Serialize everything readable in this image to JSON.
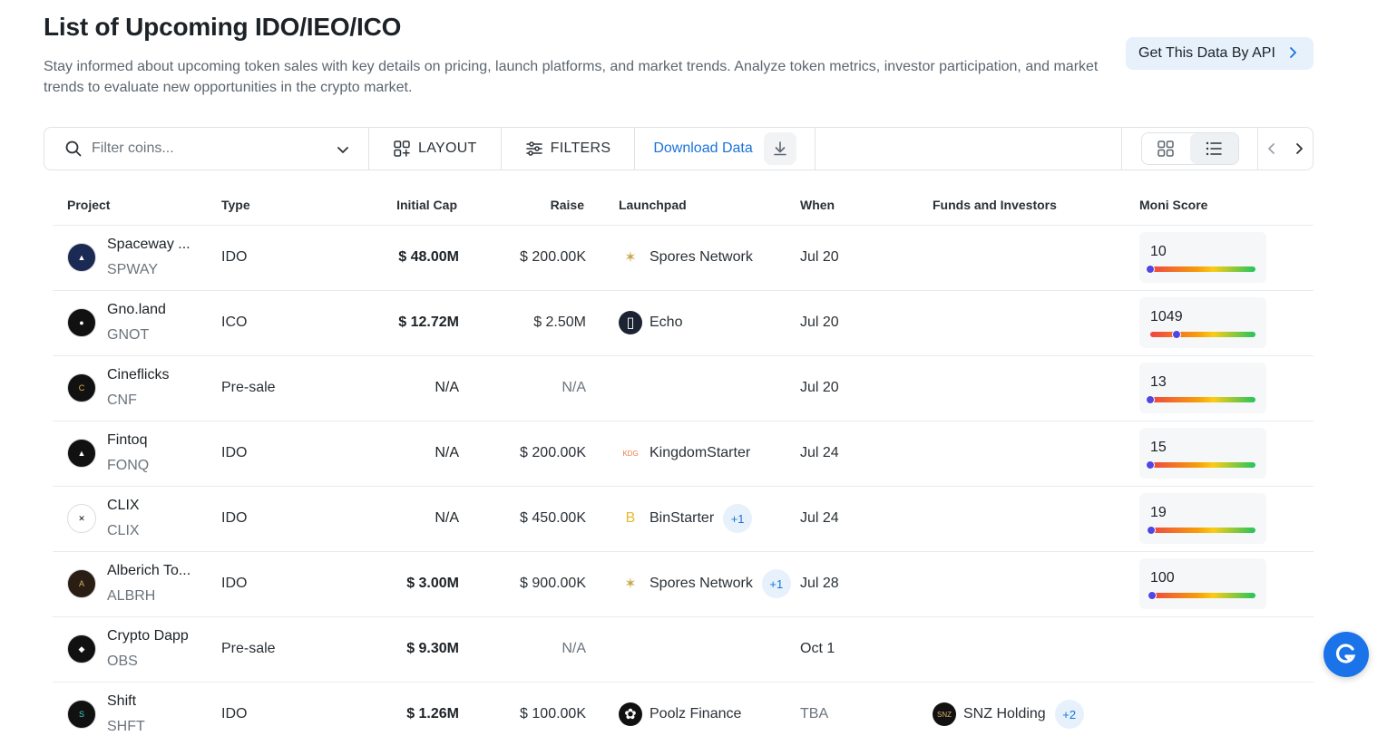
{
  "header": {
    "title": "List of Upcoming IDO/IEO/ICO",
    "subtitle": "Stay informed about upcoming token sales with key details on pricing, launch platforms, and market trends. Analyze token metrics, investor participation, and market trends to evaluate new opportunities in the crypto market.",
    "api_button": "Get This Data By API"
  },
  "toolbar": {
    "search_placeholder": "Filter coins...",
    "layout_label": "LAYOUT",
    "filters_label": "FILTERS",
    "download_label": "Download Data"
  },
  "table": {
    "columns": [
      "Project",
      "Type",
      "Initial Cap",
      "Raise",
      "Launchpad",
      "When",
      "Funds and Investors",
      "Moni Score"
    ],
    "rows": [
      {
        "name": "Spaceway ...",
        "symbol": "SPWAY",
        "type": "IDO",
        "cap": "$ 48.00M",
        "raise": "$ 200.00K",
        "launchpad": "Spores Network",
        "lp_extra": "",
        "when": "Jul 20",
        "funds": "",
        "funds_extra": "",
        "score": "10",
        "score_pos": 0.0
      },
      {
        "name": "Gno.land",
        "symbol": "GNOT",
        "type": "ICO",
        "cap": "$ 12.72M",
        "raise": "$ 2.50M",
        "launchpad": "Echo",
        "lp_extra": "",
        "when": "Jul 20",
        "funds": "",
        "funds_extra": "",
        "score": "1049",
        "score_pos": 0.25
      },
      {
        "name": "Cineflicks",
        "symbol": "CNF",
        "type": "Pre-sale",
        "cap": "N/A",
        "raise": "N/A",
        "launchpad": "",
        "lp_extra": "",
        "when": "Jul 20",
        "funds": "",
        "funds_extra": "",
        "score": "13",
        "score_pos": 0.0
      },
      {
        "name": "Fintoq",
        "symbol": "FONQ",
        "type": "IDO",
        "cap": "N/A",
        "raise": "$ 200.00K",
        "launchpad": "KingdomStarter",
        "lp_extra": "",
        "when": "Jul 24",
        "funds": "",
        "funds_extra": "",
        "score": "15",
        "score_pos": 0.0
      },
      {
        "name": "CLIX",
        "symbol": "CLIX",
        "type": "IDO",
        "cap": "N/A",
        "raise": "$ 450.00K",
        "launchpad": "BinStarter",
        "lp_extra": "+1",
        "when": "Jul 24",
        "funds": "",
        "funds_extra": "",
        "score": "19",
        "score_pos": 0.01
      },
      {
        "name": "Alberich To...",
        "symbol": "ALBRH",
        "type": "IDO",
        "cap": "$ 3.00M",
        "raise": "$ 900.00K",
        "launchpad": "Spores Network",
        "lp_extra": "+1",
        "when": "Jul 28",
        "funds": "",
        "funds_extra": "",
        "score": "100",
        "score_pos": 0.02
      },
      {
        "name": "Crypto Dapp",
        "symbol": "OBS",
        "type": "Pre-sale",
        "cap": "$ 9.30M",
        "raise": "N/A",
        "launchpad": "",
        "lp_extra": "",
        "when": "Oct 1",
        "funds": "",
        "funds_extra": "",
        "score": "",
        "score_pos": 0
      },
      {
        "name": "Shift",
        "symbol": "SHFT",
        "type": "IDO",
        "cap": "$ 1.26M",
        "raise": "$ 100.00K",
        "launchpad": "Poolz Finance",
        "lp_extra": "",
        "when": "TBA",
        "funds": "SNZ Holding",
        "funds_extra": "+2",
        "score": "",
        "score_pos": 0
      }
    ]
  },
  "colors": {
    "accent": "#1a73d9",
    "api_bg": "#e6f1fc"
  }
}
